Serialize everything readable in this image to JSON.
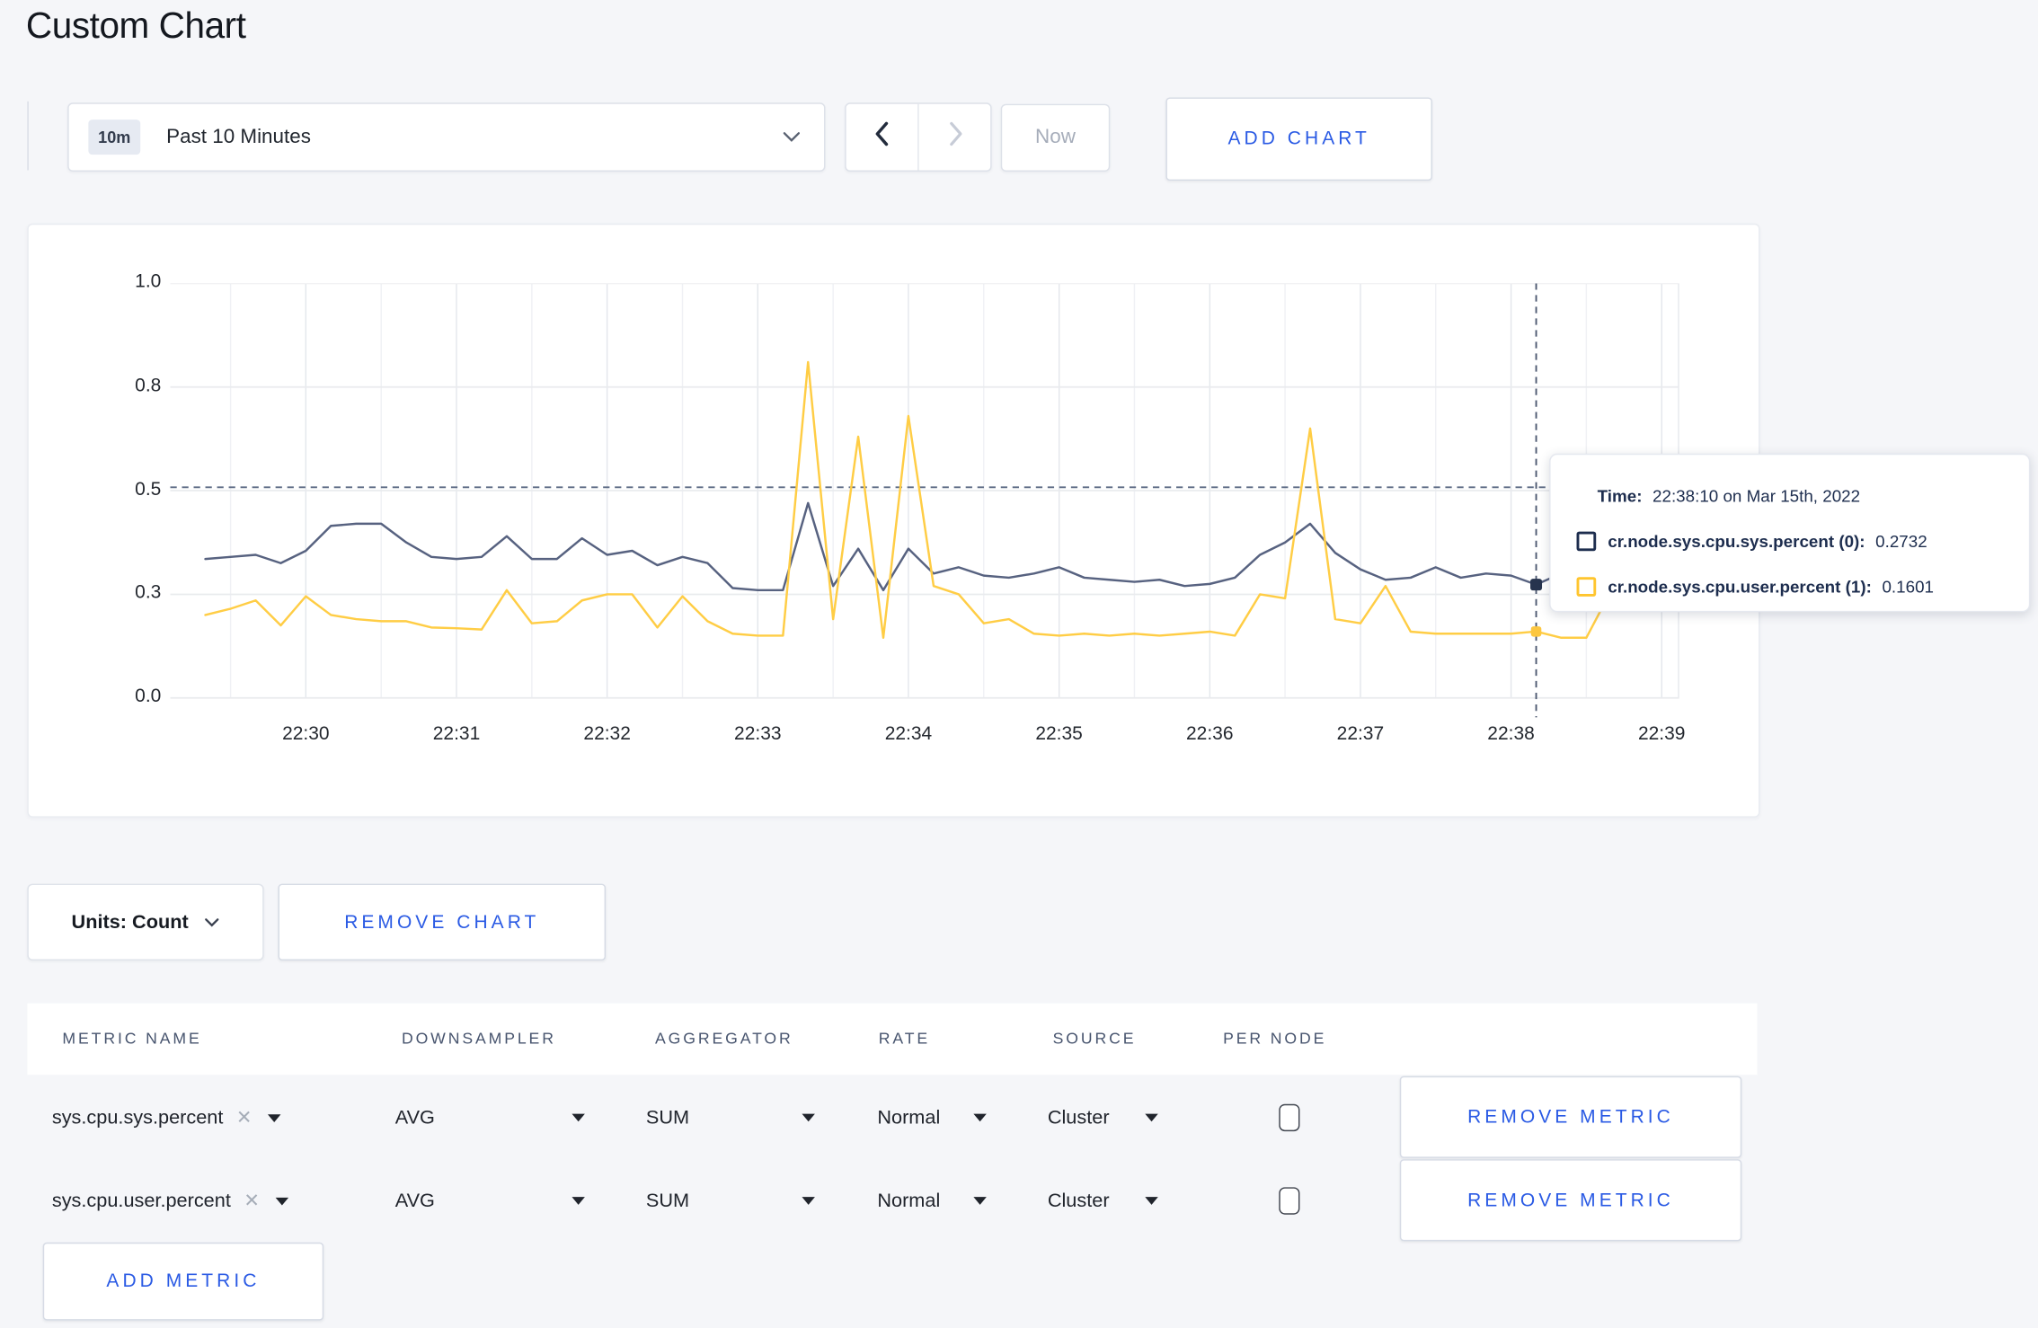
{
  "page": {
    "title": "Custom Chart"
  },
  "toolbar": {
    "time_range": {
      "badge": "10m",
      "label": "Past 10 Minutes"
    },
    "now_label": "Now",
    "add_chart_label": "ADD CHART"
  },
  "chart": {
    "units_label": "Units: Count",
    "remove_chart_label": "REMOVE CHART",
    "tooltip": {
      "time_label": "Time:",
      "time_value": "22:38:10 on Mar 15th, 2022",
      "series": [
        {
          "label": "cr.node.sys.cpu.sys.percent (0):",
          "value": "0.2732",
          "swatch_color": "#1d2d4e"
        },
        {
          "label": "cr.node.sys.cpu.user.percent (1):",
          "value": "0.1601",
          "swatch_color": "#ffc52e"
        }
      ]
    }
  },
  "chart_data": {
    "type": "line",
    "title": "",
    "xlabel": "",
    "ylabel": "",
    "ylim": [
      0,
      1
    ],
    "grid": true,
    "x_domain": [
      "22:29:06",
      "22:39:07"
    ],
    "y_ticks": [
      {
        "label": "0.0",
        "value": 0
      },
      {
        "label": "0.3",
        "value": 0.25
      },
      {
        "label": "0.5",
        "value": 0.5
      },
      {
        "label": "0.8",
        "value": 0.75
      },
      {
        "label": "1.0",
        "value": 1
      }
    ],
    "x_ticks": [
      {
        "label": "22:30",
        "time": "22:30:00"
      },
      {
        "label": "22:31",
        "time": "22:31:00"
      },
      {
        "label": "22:32",
        "time": "22:32:00"
      },
      {
        "label": "22:33",
        "time": "22:33:00"
      },
      {
        "label": "22:34",
        "time": "22:34:00"
      },
      {
        "label": "22:35",
        "time": "22:35:00"
      },
      {
        "label": "22:36",
        "time": "22:36:00"
      },
      {
        "label": "22:37",
        "time": "22:37:00"
      },
      {
        "label": "22:38",
        "time": "22:38:00"
      },
      {
        "label": "22:39",
        "time": "22:39:00"
      }
    ],
    "minor_grid_seconds": 30,
    "threshold_value": 0.508,
    "hover": {
      "time": "22:38:10",
      "sys_value": 0.2732,
      "user_value": 0.1601
    },
    "series": [
      {
        "name": "cr.node.sys.cpu.sys.percent",
        "color": "#576280",
        "dot_color": "#27344e",
        "start_time": "22:29:20",
        "step_seconds": 10,
        "values": [
          0.335,
          0.34,
          0.345,
          0.325,
          0.355,
          0.415,
          0.42,
          0.42,
          0.375,
          0.34,
          0.335,
          0.34,
          0.39,
          0.335,
          0.335,
          0.385,
          0.345,
          0.355,
          0.32,
          0.34,
          0.325,
          0.265,
          0.26,
          0.26,
          0.47,
          0.27,
          0.36,
          0.26,
          0.36,
          0.3,
          0.315,
          0.295,
          0.29,
          0.3,
          0.315,
          0.29,
          0.285,
          0.28,
          0.285,
          0.27,
          0.275,
          0.29,
          0.345,
          0.375,
          0.42,
          0.35,
          0.31,
          0.285,
          0.29,
          0.315,
          0.29,
          0.3,
          0.295,
          0.2732,
          0.3,
          0.31,
          0.3,
          0.3,
          0.31
        ]
      },
      {
        "name": "cr.node.sys.cpu.user.percent",
        "color": "#ffcd45",
        "dot_color": "#fdc740",
        "start_time": "22:29:20",
        "step_seconds": 10,
        "values": [
          0.2,
          0.215,
          0.235,
          0.175,
          0.245,
          0.2,
          0.19,
          0.185,
          0.185,
          0.17,
          0.168,
          0.165,
          0.26,
          0.18,
          0.185,
          0.235,
          0.25,
          0.25,
          0.17,
          0.245,
          0.185,
          0.155,
          0.15,
          0.15,
          0.81,
          0.19,
          0.63,
          0.145,
          0.68,
          0.27,
          0.25,
          0.18,
          0.19,
          0.155,
          0.15,
          0.155,
          0.15,
          0.155,
          0.15,
          0.155,
          0.16,
          0.15,
          0.25,
          0.24,
          0.65,
          0.19,
          0.18,
          0.27,
          0.16,
          0.155,
          0.155,
          0.155,
          0.155,
          0.1601,
          0.145,
          0.145,
          0.26,
          0.265,
          0.22
        ]
      }
    ],
    "legend_position": "none"
  },
  "metrics_table": {
    "headers": [
      "METRIC NAME",
      "DOWNSAMPLER",
      "AGGREGATOR",
      "RATE",
      "SOURCE",
      "PER NODE"
    ],
    "rows": [
      {
        "name": "sys.cpu.sys.percent",
        "downsampler": "AVG",
        "aggregator": "SUM",
        "rate": "Normal",
        "source": "Cluster",
        "per_node_checked": false,
        "remove_label": "REMOVE METRIC"
      },
      {
        "name": "sys.cpu.user.percent",
        "downsampler": "AVG",
        "aggregator": "SUM",
        "rate": "Normal",
        "source": "Cluster",
        "per_node_checked": false,
        "remove_label": "REMOVE METRIC"
      }
    ],
    "add_metric_label": "ADD METRIC"
  }
}
